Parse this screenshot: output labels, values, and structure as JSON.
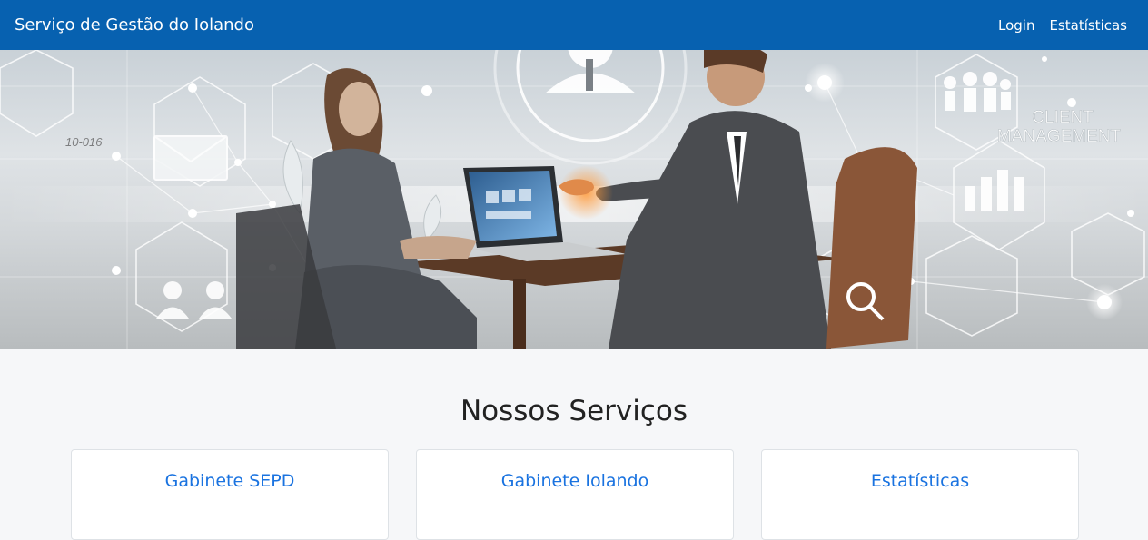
{
  "navbar": {
    "brand": "Serviço de Gestão do Iolando",
    "links": [
      "Login",
      "Estatísticas"
    ]
  },
  "hero": {
    "overlay_text_line1": "CLIENT",
    "overlay_text_line2": "MANAGEMENT",
    "overlay_small_text": "10-016"
  },
  "services": {
    "title": "Nossos Serviços",
    "cards": [
      "Gabinete SEPD",
      "Gabinete Iolando",
      "Estatísticas"
    ]
  },
  "colors": {
    "navbar_bg": "#0761b0",
    "link": "#1a73e0",
    "page_bg": "#f6f7f9"
  }
}
